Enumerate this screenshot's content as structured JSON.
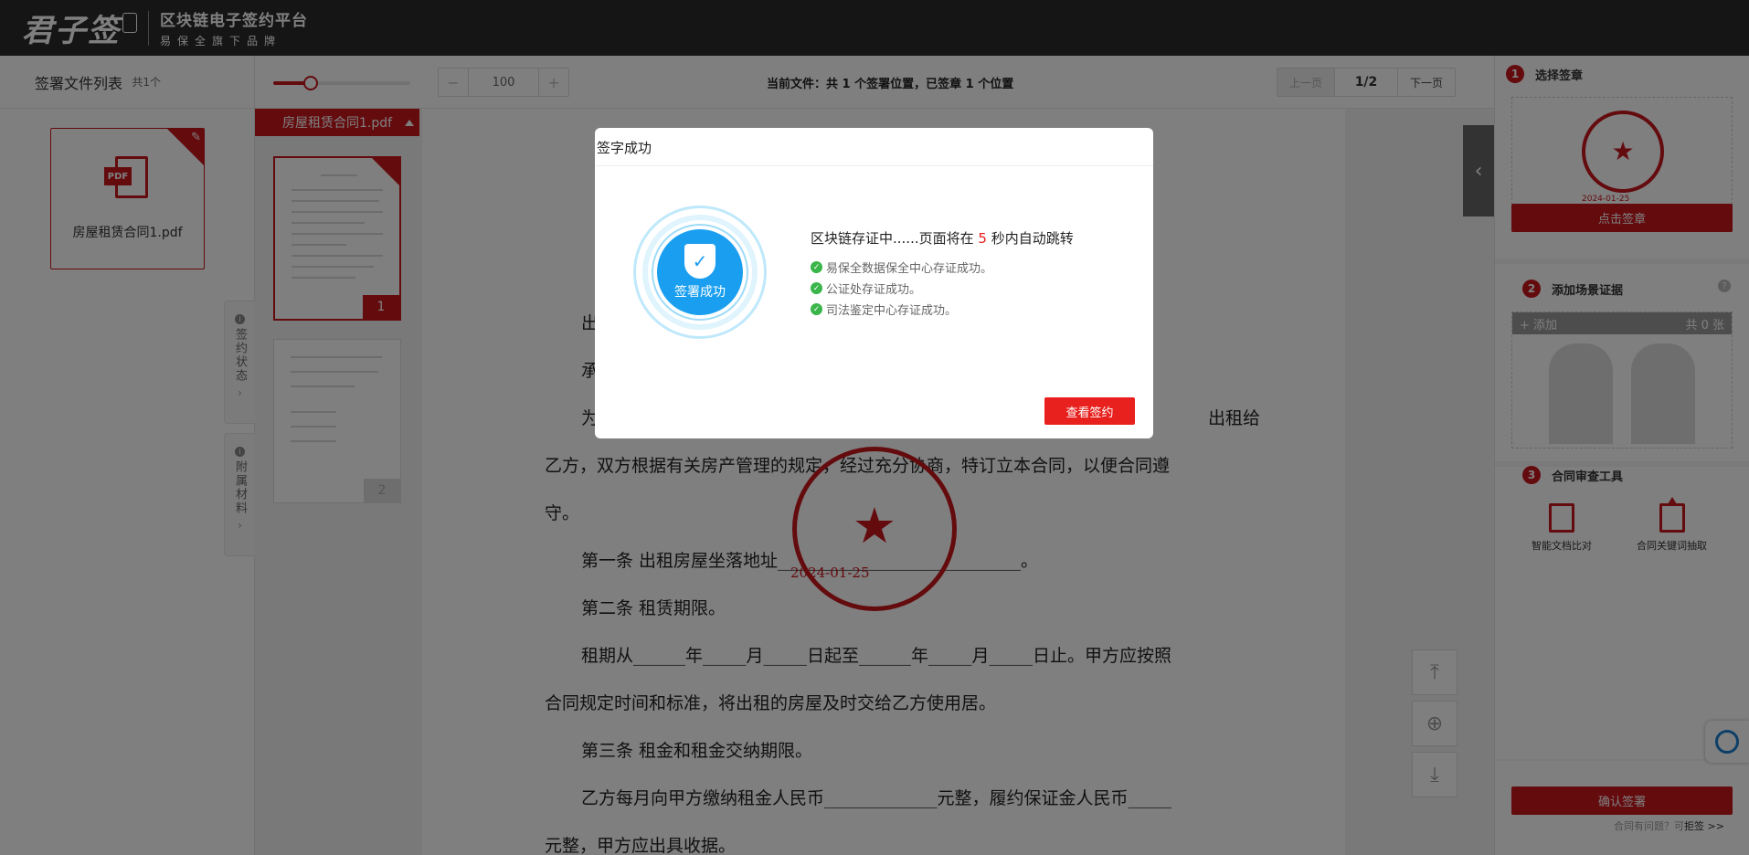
{
  "header": {
    "logo_text": "君子签",
    "platform_name": "区块链电子签约平台",
    "brand_tagline": "易保全旗下品牌"
  },
  "file_list": {
    "title": "签署文件列表",
    "count": "共1个",
    "files": [
      {
        "name": "房屋租赁合同1.pdf",
        "icon": "pdf-icon",
        "tag": "PDF"
      }
    ],
    "side_tabs": [
      {
        "label": "签约状态",
        "icon": "chevron-right-icon"
      },
      {
        "label": "附属材料",
        "icon": "chevron-right-icon"
      }
    ]
  },
  "toolbar": {
    "zoom_slider_fraction": 0.27,
    "zoom_minus": "−",
    "zoom_value": "100",
    "zoom_plus": "+",
    "current_file_status": "当前文件：共 1 个签署位置，已签章 1 个位置",
    "prev_page": "上一页",
    "page_indicator": "1/2",
    "next_page": "下一页"
  },
  "thumbnails": {
    "file_title": "房屋租赁合同1.pdf",
    "pages": [
      {
        "number": "1",
        "active": true
      },
      {
        "number": "2",
        "active": false
      }
    ]
  },
  "document": {
    "lines": [
      "出",
      "承",
      "为",
      "出租给",
      "乙方，双方根据有关房产管理的规定，经过充分协商，特订立本合同，以便合同遵",
      "守。",
      "第一条  出租房屋坐落地址____________________________。",
      "第二条  租赁期限。",
      "租期从______年_____月_____日起至______年_____月_____日止。甲方应按照",
      "合同规定时间和标准，将出租的房屋及时交给乙方使用居。",
      "第三条  租金和租金交纳期限。",
      "乙方每月向甲方缴纳租金人民币_____________元整，履约保证金人民币_____",
      "元整，甲方应出具收据。"
    ],
    "stamp_date": "2024-01-25",
    "stamp_color": "#c8161d"
  },
  "right_panel": {
    "step1": {
      "number": "1",
      "title": "选择签章",
      "seal_date": "2024-01-25",
      "button": "点击签章"
    },
    "step2": {
      "number": "2",
      "title": "添加场景证据",
      "add_label": "+ 添加",
      "count_label": "共 0 张"
    },
    "step3": {
      "number": "3",
      "title": "合同审查工具",
      "tools": [
        "智能文档比对",
        "合同关键词抽取"
      ]
    },
    "confirm_button": "确认签署",
    "help_text": "合同有问题？可",
    "reject_link": "拒签 >>"
  },
  "modal": {
    "title": "签字成功",
    "badge_text": "签署成功",
    "message_prefix": "区块链存证中......页面将在",
    "countdown": "5",
    "message_suffix": "秒内自动跳转",
    "items": [
      "易保全数据保全中心存证成功。",
      "公证处存证成功。",
      "司法鉴定中心存证成功。"
    ],
    "button": "查看签约",
    "accent_color": "#e8211e",
    "badge_color": "#1a9ff0"
  }
}
